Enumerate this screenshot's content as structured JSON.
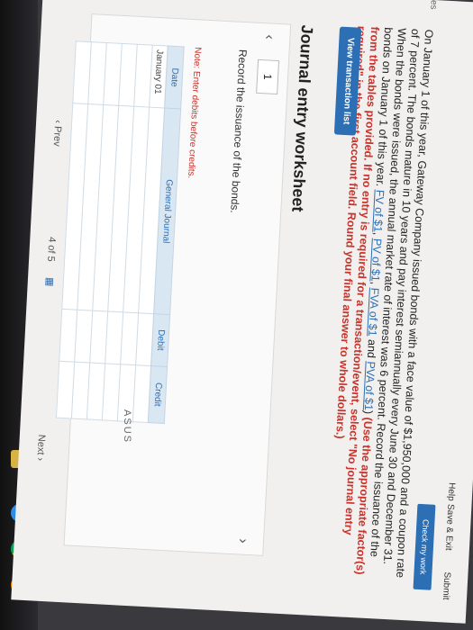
{
  "topbar": {
    "help": "Help",
    "save_exit": "Save & Exit",
    "submit": "Submit",
    "check_work": "Check my work"
  },
  "side_label": "ces",
  "problem": {
    "text_1": "On January 1 of this year, Gateway Company issued bonds with a face value of $1,950,000 and a coupon rate of 7 percent. The bonds mature in 10 years and pay interest semiannually every June 30 and December 31. When the bonds were issued, the annual market rate of interest was 6 percent. Record the issuance of the bonds on January 1 of this year. ",
    "links": [
      "FV of $1",
      "PV of $1",
      "FVA of $1",
      "PVA of $1"
    ],
    "bold_text": "(Use the appropriate factor(s) from the tables provided. If no entry is required for a transaction/event, select \"No journal entry required\" in the first account field. Round your final answer to whole dollars.)"
  },
  "view_transaction_button": "View transaction list",
  "worksheet": {
    "title": "Journal entry worksheet",
    "step": "1",
    "instruction": "Record the issuance of the bonds.",
    "note": "Note: Enter debits before credits.",
    "columns": [
      "Date",
      "General Journal",
      "Debit",
      "Credit"
    ],
    "rows": [
      {
        "date": "January 01"
      },
      {
        "date": ""
      },
      {
        "date": ""
      },
      {
        "date": ""
      },
      {
        "date": ""
      },
      {
        "date": ""
      }
    ]
  },
  "pager": {
    "prev": "Prev",
    "current": "4",
    "of": "of",
    "total": "5",
    "next": "Next"
  },
  "taskbar_icons": [
    "edge-icon",
    "chrome-icon",
    "firefox-icon"
  ],
  "bezel_brand": "ASUS"
}
